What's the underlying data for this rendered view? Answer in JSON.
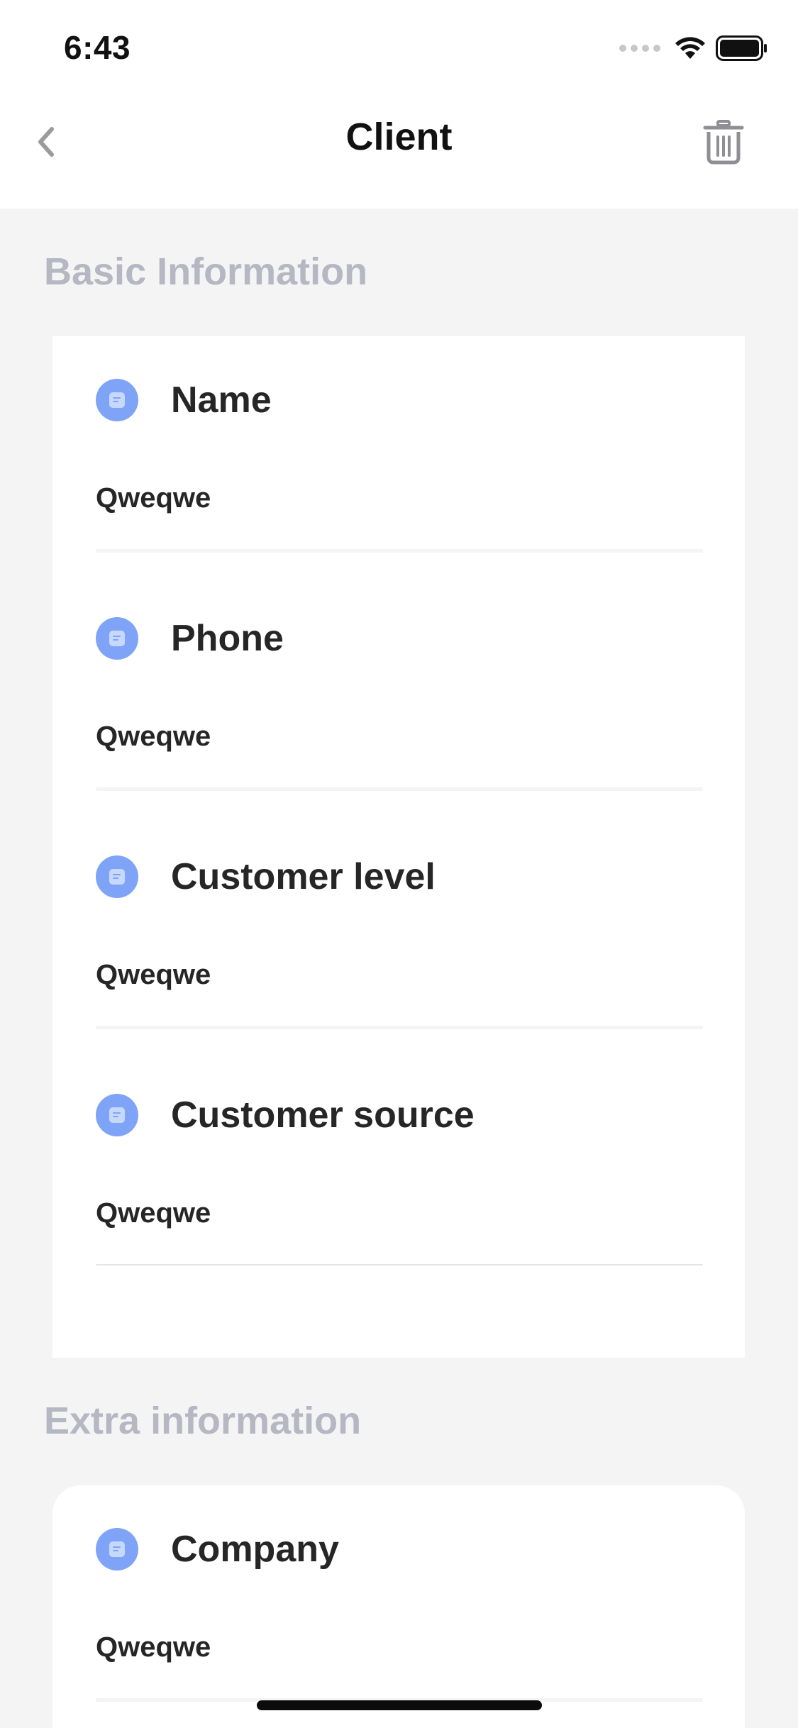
{
  "status_bar": {
    "time": "6:43",
    "icons": [
      "signal-icon",
      "wifi-icon",
      "battery-icon"
    ]
  },
  "nav": {
    "title": "Client",
    "back_icon": "chevron-left-icon",
    "trash_icon": "trash-icon"
  },
  "sections": {
    "basic": {
      "title": "Basic Information",
      "fields": [
        {
          "label": "Name",
          "value": "Qweqwe"
        },
        {
          "label": "Phone",
          "value": "Qweqwe"
        },
        {
          "label": "Customer level",
          "value": "Qweqwe"
        },
        {
          "label": "Customer source",
          "value": "Qweqwe"
        }
      ]
    },
    "extra": {
      "title": "Extra information",
      "fields": [
        {
          "label": "Company",
          "value": "Qweqwe"
        }
      ]
    }
  },
  "colors": {
    "accent": "#7fa4f7",
    "section_title": "#b5b7c2",
    "background": "#f4f4f5",
    "card": "#ffffff",
    "text": "#262626"
  }
}
